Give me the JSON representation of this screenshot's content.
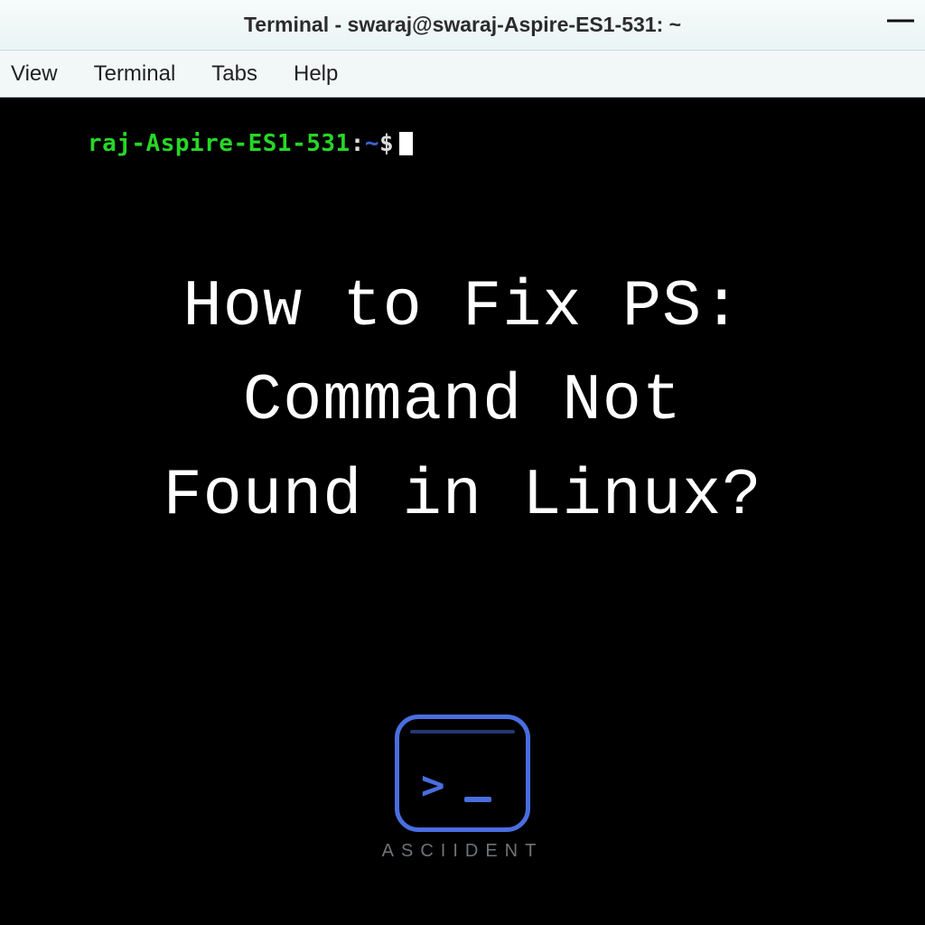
{
  "window": {
    "title": "Terminal - swaraj@swaraj-Aspire-ES1-531: ~",
    "minimize_glyph": "—"
  },
  "menubar": {
    "items": [
      "View",
      "Terminal",
      "Tabs",
      "Help"
    ]
  },
  "prompt": {
    "host": "raj-Aspire-ES1-531",
    "sep": ":",
    "path": "~",
    "dollar": "$"
  },
  "overlay": {
    "line1": "How to Fix PS:",
    "line2": "Command Not",
    "line3": "Found in Linux?"
  },
  "logo": {
    "prompt_glyph": ">",
    "brand": "ASCIIDENT"
  }
}
